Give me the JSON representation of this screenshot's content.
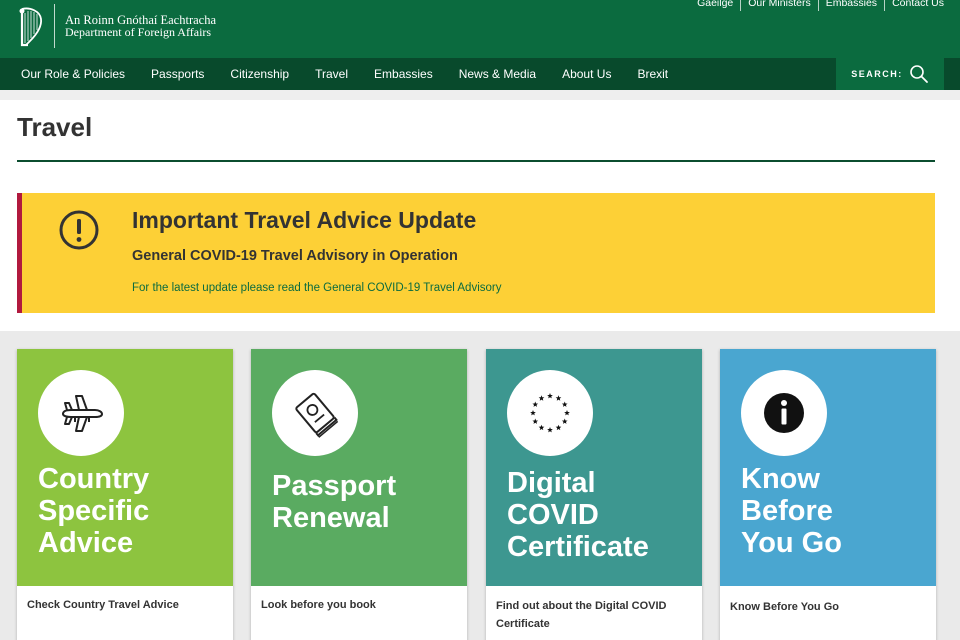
{
  "header": {
    "dept_irish": "An Roinn Gnóthaí Eachtracha",
    "dept_english": "Department of Foreign Affairs",
    "utility_links": [
      "Gaeilge",
      "Our Ministers",
      "Embassies",
      "Contact Us"
    ],
    "brand_color": "#0b6b3f"
  },
  "nav": {
    "items": [
      "Our Role & Policies",
      "Passports",
      "Citizenship",
      "Travel",
      "Embassies",
      "News & Media",
      "About Us",
      "Brexit"
    ],
    "search_label": "SEARCH:",
    "search_icon": "search-icon",
    "bar_color": "#084a2c"
  },
  "page": {
    "title": "Travel"
  },
  "alert": {
    "icon": "exclamation-circle-icon",
    "title": "Important Travel Advice Update",
    "subtitle": "General COVID-19 Travel Advisory in Operation",
    "link_text": "For the latest update please read the General COVID-19 Travel Advisory",
    "background": "#fdd036",
    "accent": "#b1193e"
  },
  "cards": [
    {
      "icon": "airplane-icon",
      "title_lines": [
        "Country",
        "Specific",
        "Advice"
      ],
      "description": "Check Country Travel Advice",
      "color": "#8dc43f"
    },
    {
      "icon": "passport-icon",
      "title_lines": [
        "Passport",
        "Renewal"
      ],
      "description": "Look before you book",
      "color": "#5aab61"
    },
    {
      "icon": "eu-stars-icon",
      "title_lines": [
        "Digital",
        "COVID",
        "Certificate"
      ],
      "description": "Find out about the Digital COVID Certificate",
      "color": "#3d9790"
    },
    {
      "icon": "info-icon",
      "title_lines": [
        "Know",
        "Before",
        "You Go"
      ],
      "description": "Know Before You Go",
      "color": "#4aa6d0"
    }
  ]
}
